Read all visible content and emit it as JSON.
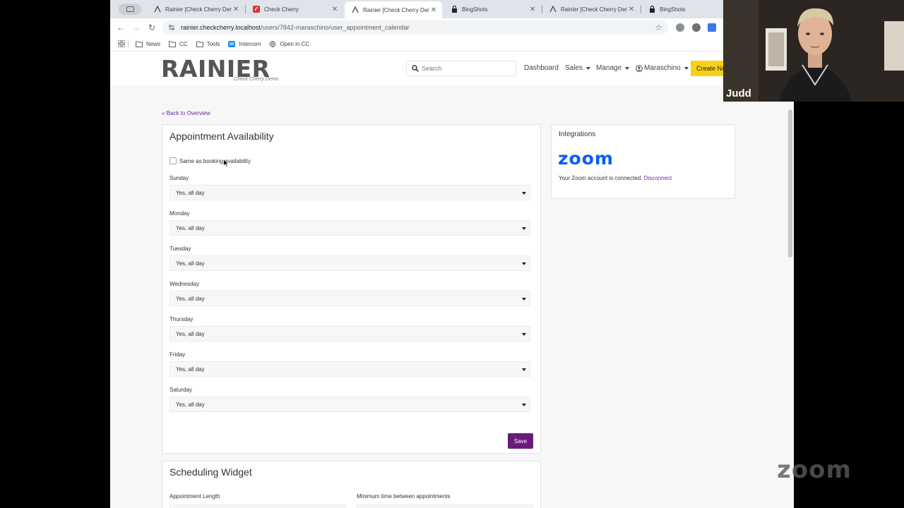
{
  "browser": {
    "tabs": [
      {
        "title": "Rainier [Check Cherry Demo]",
        "favicon": "rainier-favicon",
        "active": false
      },
      {
        "title": "Check Cherry",
        "favicon": "checkcherry-favicon",
        "active": false
      },
      {
        "title": "Rainier [Check Cherry Demo]",
        "favicon": "rainier-favicon",
        "active": true
      },
      {
        "title": "BingShots",
        "favicon": "lock-icon",
        "active": false
      },
      {
        "title": "Rainier [Check Cherry Demo]",
        "favicon": "rainier-favicon",
        "active": false
      },
      {
        "title": "BingShots",
        "favicon": "lock-icon",
        "active": false
      }
    ],
    "url_host": "rainier.checkcherry.localhost",
    "url_path": "/users/7842-maraschino/user_appointment_calendar",
    "bookmarks": [
      {
        "label": "News",
        "icon": "folder-icon"
      },
      {
        "label": "CC",
        "icon": "folder-icon"
      },
      {
        "label": "Tools",
        "icon": "folder-icon"
      },
      {
        "label": "Intercom",
        "icon": "intercom-icon"
      },
      {
        "label": "Open in CC",
        "icon": "globe-icon"
      }
    ]
  },
  "app": {
    "logo_text": "RAINIER",
    "logo_subtitle": "Check Cherry Demo",
    "search_placeholder": "Search",
    "nav": {
      "dashboard": "Dashboard",
      "sales": "Sales",
      "manage": "Manage",
      "user": "Maraschino",
      "create": "Create New"
    },
    "back_link": "« Back to Overview"
  },
  "availability": {
    "title": "Appointment Availability",
    "same_as_label": "Same as booking availability",
    "same_as_checked": false,
    "days": [
      {
        "label": "Sunday",
        "value": "Yes, all day"
      },
      {
        "label": "Monday",
        "value": "Yes, all day"
      },
      {
        "label": "Tuesday",
        "value": "Yes, all day"
      },
      {
        "label": "Wednesday",
        "value": "Yes, all day"
      },
      {
        "label": "Thursday",
        "value": "Yes, all day"
      },
      {
        "label": "Friday",
        "value": "Yes, all day"
      },
      {
        "label": "Saturday",
        "value": "Yes, all day"
      }
    ],
    "save_label": "Save"
  },
  "integrations": {
    "title": "Integrations",
    "zoom_logo": "zoom",
    "status_text": "Your Zoom account is connected.",
    "disconnect_label": "Disconnect"
  },
  "widget": {
    "title": "Scheduling Widget",
    "appointment_length_label": "Appointment Length",
    "min_time_label": "Minimum time between appointments"
  },
  "meeting": {
    "participant_name": "Judd",
    "watermark": "zoom"
  },
  "colors": {
    "accent_purple": "#6a1b7a",
    "link_purple": "#6b2aa0",
    "create_yellow": "#f7d117",
    "zoom_blue": "#0b5cff"
  }
}
